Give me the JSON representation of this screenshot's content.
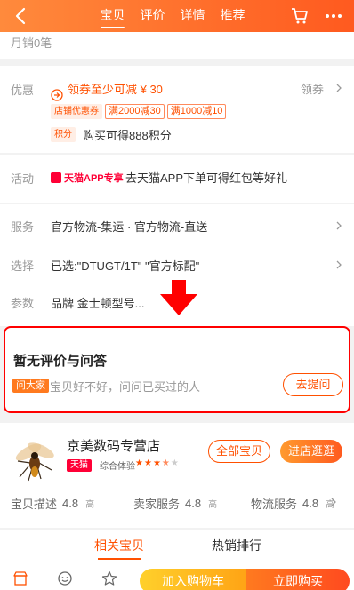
{
  "header": {
    "tabs": [
      {
        "label": "宝贝",
        "active": true
      },
      {
        "label": "评价",
        "active": false
      },
      {
        "label": "详情",
        "active": false
      },
      {
        "label": "推荐",
        "active": false
      }
    ],
    "icons": [
      "back-icon",
      "cart-icon",
      "more-icon"
    ]
  },
  "sales": {
    "text": "月销0笔"
  },
  "promo": {
    "label": "优惠",
    "coupon_text": "领券至少可减 ¥ 30",
    "coupon_action": "领券",
    "tags": [
      "店铺优惠券",
      "满2000减30",
      "满1000减10"
    ],
    "points_badge": "积分",
    "points_text": "购买可得888积分"
  },
  "event": {
    "label": "活动",
    "tag": "天猫APP专享",
    "text": "去天猫APP下单可得红包等好礼"
  },
  "service": {
    "service_label": "服务",
    "service_value": "官方物流-集运 · 官方物流-直送",
    "select_label": "选择",
    "select_value": "已选:\"DTUGT/1T\" \"官方标配\"",
    "param_label": "参数",
    "param_value": "品牌 金士顿型号..."
  },
  "qa": {
    "title": "暂无评价与问答",
    "tag": "问大家",
    "hint": "宝贝好不好，问问已买过的人",
    "button": "去提问"
  },
  "shop": {
    "name": "京美数码专营店",
    "badge": "天猫",
    "experience_label": "综合体验",
    "stars": 3.5,
    "all_items_button": "全部宝贝",
    "visit_button": "进店逛逛",
    "ratings": [
      {
        "label": "宝贝描述",
        "score": "4.8",
        "level": "高"
      },
      {
        "label": "卖家服务",
        "score": "4.8",
        "level": "高"
      },
      {
        "label": "物流服务",
        "score": "4.8",
        "level": "高"
      }
    ]
  },
  "tabs2": {
    "related": "相关宝贝",
    "hot": "热销排行"
  },
  "bottom": {
    "add_cart": "加入购物车",
    "buy_now": "立即购买"
  },
  "colors": {
    "accent": "#ff5000",
    "header": "#ff7a2f",
    "highlight_box": "#ff0000"
  }
}
